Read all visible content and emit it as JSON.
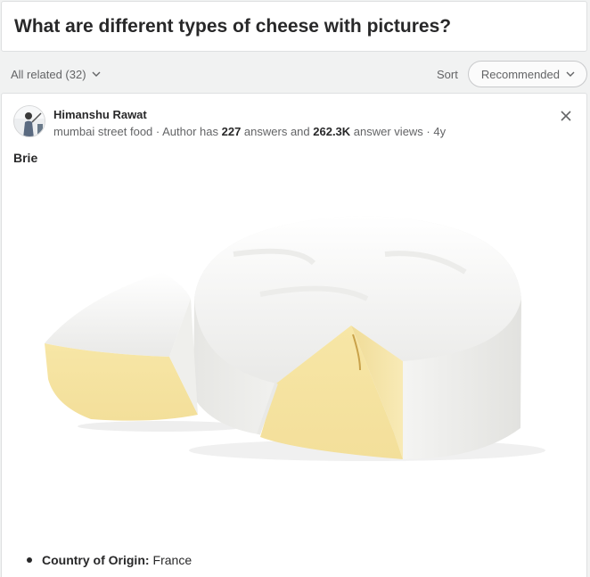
{
  "question": {
    "title": "What are different types of cheese with pictures?"
  },
  "related": {
    "label": "All related (32)",
    "sort_label": "Sort",
    "sort_value": "Recommended"
  },
  "answer": {
    "author_name": "Himanshu Rawat",
    "credential_prefix": "mumbai street food · Author has ",
    "answers_count": "227",
    "answers_mid": " answers and ",
    "views_count": "262.3K",
    "credential_suffix": " answer views · 4y",
    "subheading": "Brie",
    "bullets": [
      {
        "label": "Country of Origin:",
        "value": "France"
      }
    ]
  },
  "colors": {
    "background": "#f1f2f2",
    "card": "#ffffff",
    "text": "#282829",
    "muted": "#636466"
  }
}
